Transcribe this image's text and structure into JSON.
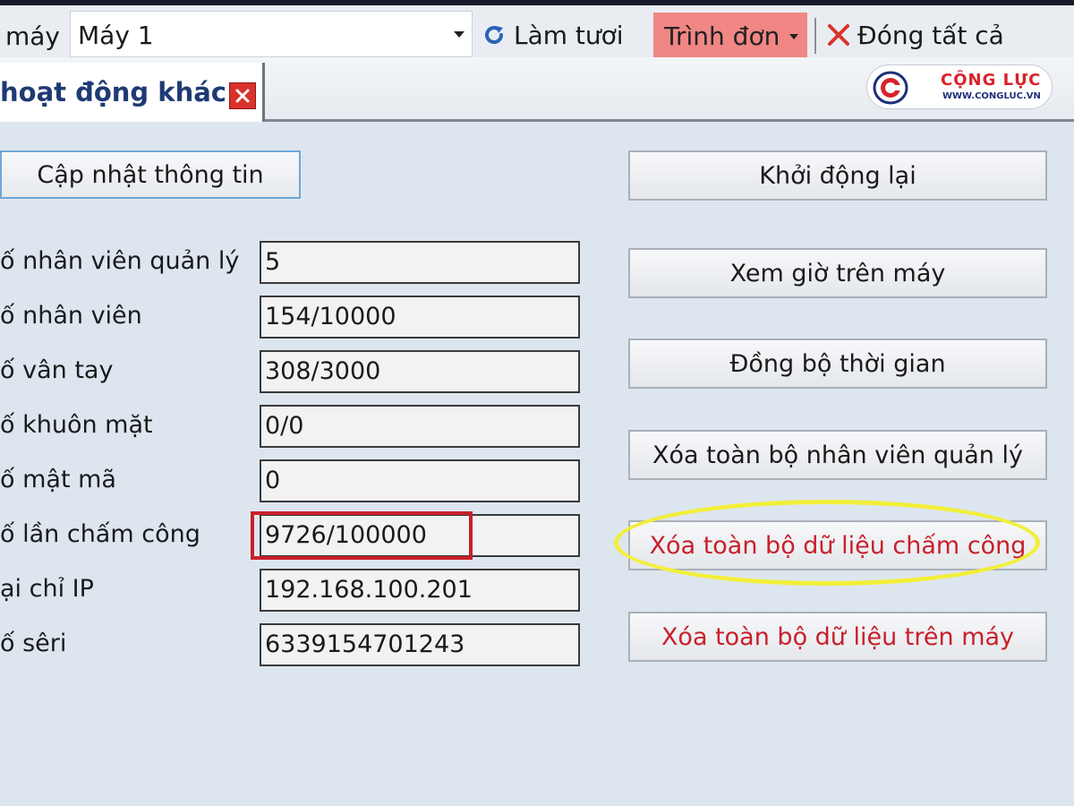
{
  "toolbar": {
    "machine_label": "máy",
    "machine_value": "Máy 1",
    "refresh_label": "Làm tươi",
    "menu_label": "Trình đơn",
    "close_all_label": "Đóng tất cả"
  },
  "tab": {
    "title": "hoạt động khác"
  },
  "logo": {
    "brand": "CỘNG LỰC",
    "url": "WWW.CONGLUC.VN"
  },
  "form": {
    "update_button": "Cập nhật thông tin",
    "fields": [
      {
        "label": "ố nhân viên quản lý",
        "value": "5"
      },
      {
        "label": "ố nhân viên",
        "value": "154/10000"
      },
      {
        "label": "ố vân tay",
        "value": "308/3000"
      },
      {
        "label": "ố khuôn mặt",
        "value": "0/0"
      },
      {
        "label": "ố mật mã",
        "value": "0"
      },
      {
        "label": "ố lần chấm công",
        "value": "9726/100000"
      },
      {
        "label": "ại chỉ IP",
        "value": "192.168.100.201"
      },
      {
        "label": "ố sêri",
        "value": "6339154701243"
      }
    ]
  },
  "actions": {
    "restart": "Khởi động lại",
    "view_time": "Xem giờ trên máy",
    "sync_time": "Đồng bộ thời gian",
    "delete_admins": "Xóa toàn bộ nhân viên quản lý",
    "delete_attendance": "Xóa toàn bộ dữ liệu chấm công",
    "delete_all": "Xóa toàn bộ dữ liệu trên máy"
  },
  "colors": {
    "danger_text": "#c8202a",
    "highlight_yellow": "#f2ef3a",
    "menu_bg": "#f08784",
    "focus_border": "#6fa7d8"
  }
}
